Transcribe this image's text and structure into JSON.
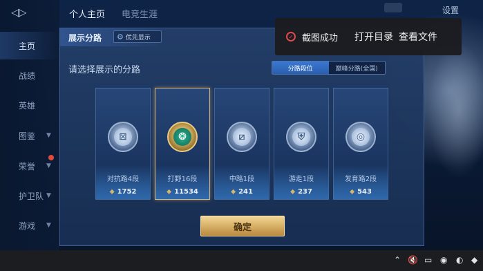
{
  "sidebar": {
    "items": [
      {
        "label": "主页",
        "active": true,
        "chevron": false,
        "dot": false
      },
      {
        "label": "战绩",
        "active": false,
        "chevron": false,
        "dot": false
      },
      {
        "label": "英雄",
        "active": false,
        "chevron": false,
        "dot": false
      },
      {
        "label": "图鉴",
        "active": false,
        "chevron": true,
        "dot": false
      },
      {
        "label": "荣誉",
        "active": false,
        "chevron": true,
        "dot": true
      },
      {
        "label": "护卫队",
        "active": false,
        "chevron": true,
        "dot": false
      },
      {
        "label": "游戏",
        "active": false,
        "chevron": true,
        "dot": false
      }
    ]
  },
  "top_tabs": [
    "个人主页",
    "电竞生涯"
  ],
  "top_right": {
    "settings_label": "设置"
  },
  "panel": {
    "title": "展示分路",
    "priority_label": "优先显示",
    "prompt": "请选择展示的分路",
    "toggle": [
      {
        "label": "分路段位",
        "active": true
      },
      {
        "label": "巅峰分路(全国)",
        "active": false
      }
    ],
    "cards": [
      {
        "name": "对抗路4段",
        "score": "1752",
        "icon": "clash-lane-icon",
        "glyph": "⊠",
        "selected": false
      },
      {
        "name": "打野16段",
        "score": "11534",
        "icon": "jungle-icon",
        "glyph": "❂",
        "selected": true
      },
      {
        "name": "中路1段",
        "score": "241",
        "icon": "mid-lane-icon",
        "glyph": "⧄",
        "selected": false
      },
      {
        "name": "游走1段",
        "score": "237",
        "icon": "roam-icon",
        "glyph": "⛨",
        "selected": false
      },
      {
        "name": "发育路2段",
        "score": "543",
        "icon": "farm-lane-icon",
        "glyph": "◎",
        "selected": false
      }
    ],
    "confirm_label": "确定"
  },
  "toast": {
    "message": "截图成功",
    "open_folder": "打开目录",
    "view_file": "查看文件"
  },
  "colors": {
    "accent_gold": "#d7b066",
    "accent_blue": "#3a78d0",
    "toast_icon": "#e04a4a"
  }
}
